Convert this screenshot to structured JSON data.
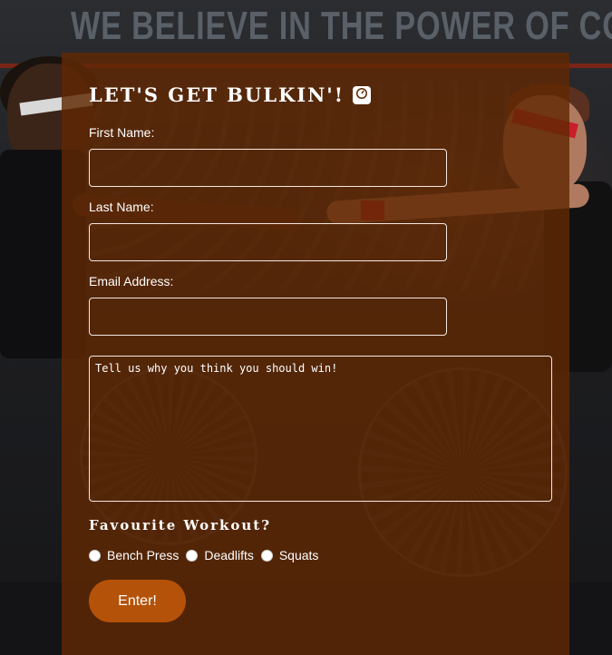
{
  "background": {
    "banner_text": "WE BELIEVE IN THE POWER OF COMMUNI"
  },
  "form": {
    "title": "LET'S GET BULKIN'!",
    "title_icon": "scale-icon",
    "fields": {
      "first_name": {
        "label": "First Name:",
        "value": ""
      },
      "last_name": {
        "label": "Last Name:",
        "value": ""
      },
      "email": {
        "label": "Email Address:",
        "value": ""
      }
    },
    "message": {
      "placeholder": "Tell us why you think you should win!",
      "value": ""
    },
    "workout": {
      "heading": "Favourite Workout?",
      "options": [
        "Bench Press",
        "Deadlifts",
        "Squats"
      ],
      "selected": ""
    },
    "submit_label": "Enter!"
  },
  "colors": {
    "panel": "#602804",
    "button": "#b5520a",
    "text": "#ffffff"
  }
}
